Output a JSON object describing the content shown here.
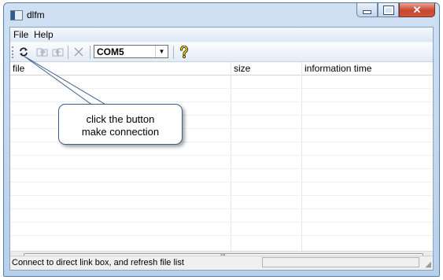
{
  "window": {
    "title": "dlfm"
  },
  "menu": {
    "items": [
      "File",
      "Help"
    ]
  },
  "toolbar": {
    "port": "COM5"
  },
  "list": {
    "columns": [
      "file",
      "size",
      "information time"
    ]
  },
  "status": {
    "text": "Connect to direct link box, and refresh file list"
  },
  "callout": {
    "line1": "click the button",
    "line2": "make connection"
  },
  "colors": {
    "title_bar": "#b8d0ea",
    "close_button": "#c8452e",
    "callout_border": "#3b5f8c"
  },
  "icons": [
    "app-window-icon",
    "refresh-connect-icon",
    "download-icon",
    "upload-icon",
    "delete-x-icon",
    "help-question-icon"
  ]
}
